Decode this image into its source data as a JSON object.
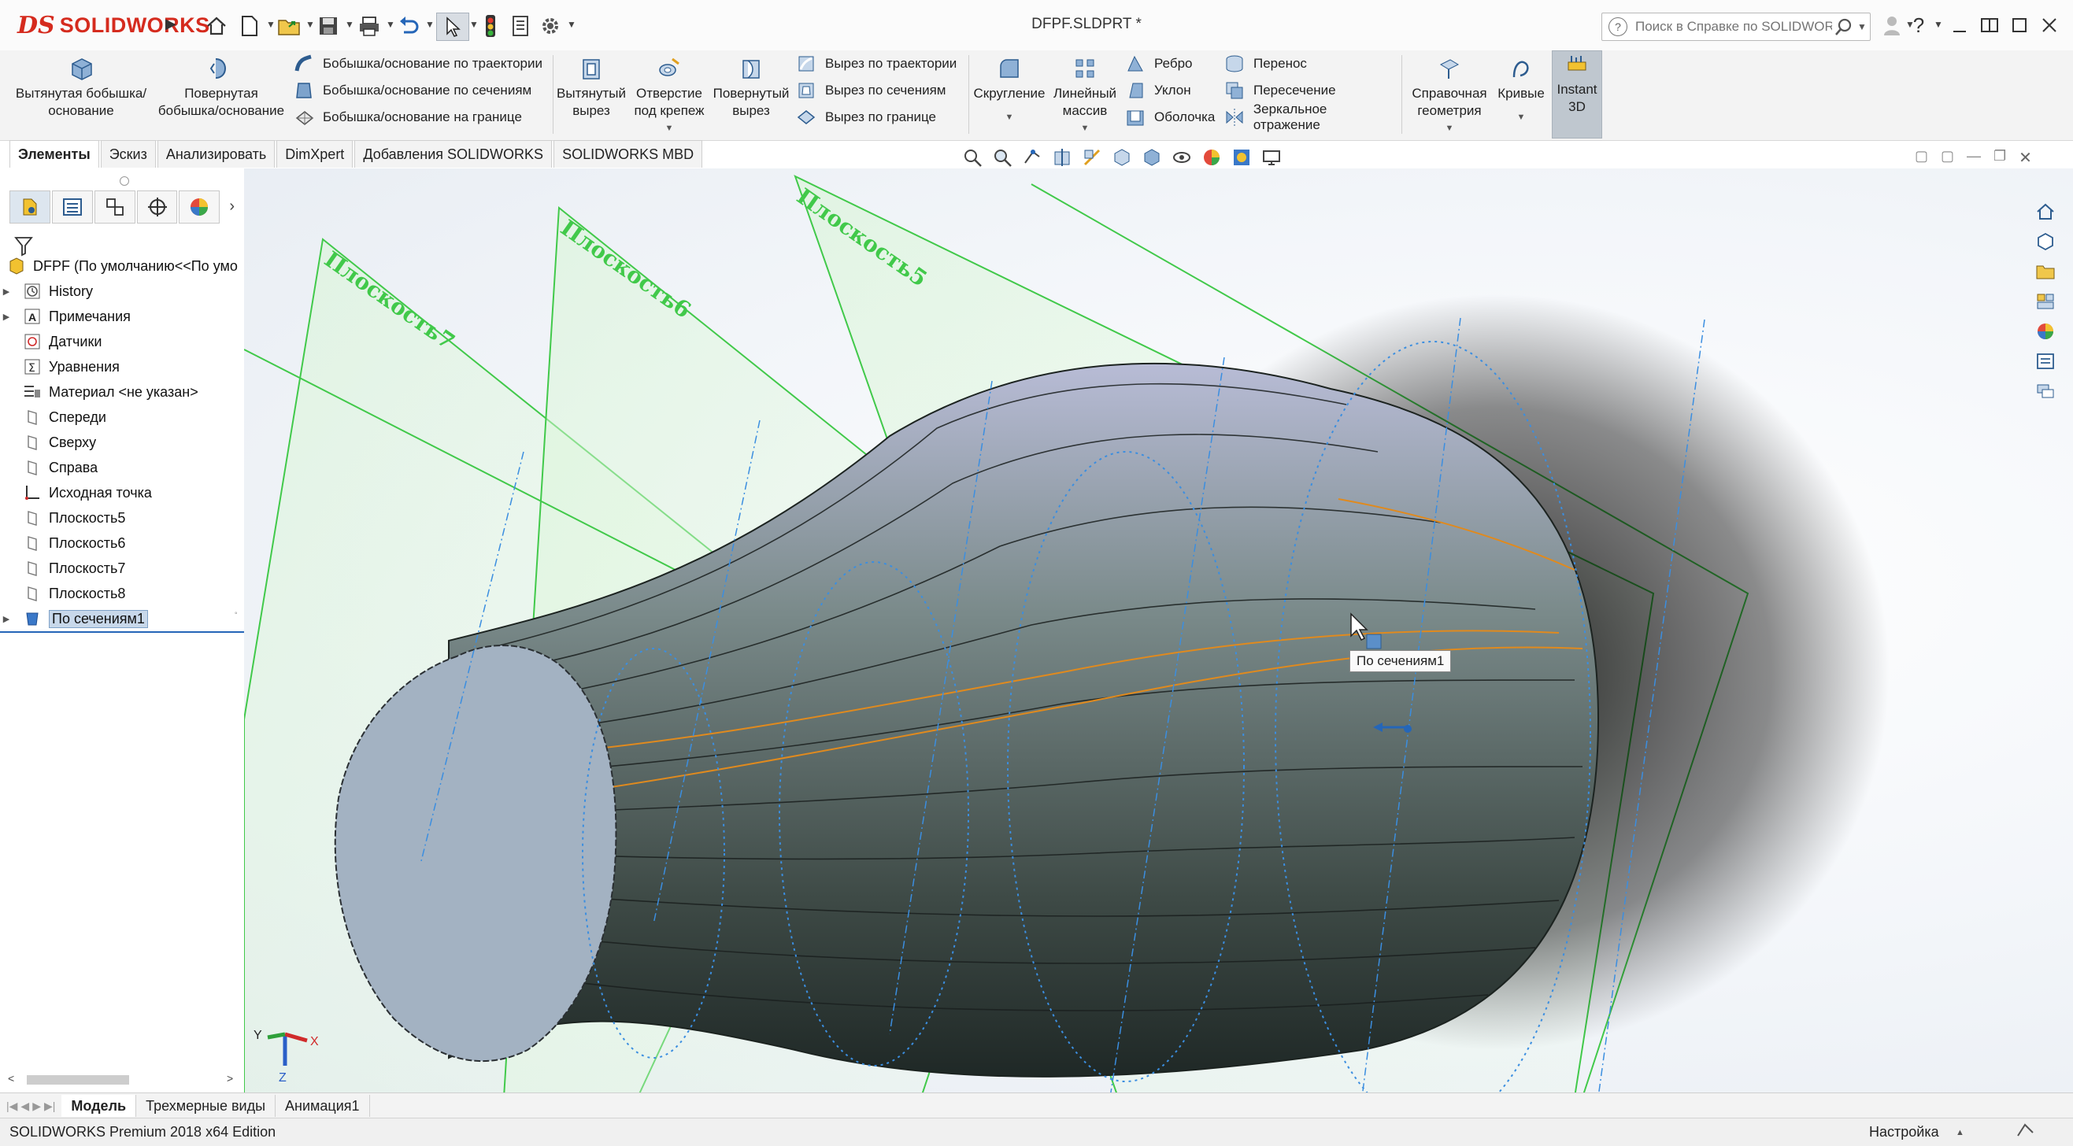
{
  "window": {
    "doc_title": "DFPF.SLDPRT *",
    "search_placeholder": "Поиск в Справке по SOLIDWORKS",
    "help_glyph": "?"
  },
  "ribbon": {
    "extruded_boss": "Вытянутая бобышка/основание",
    "revolved_boss": "Повернутая бобышка/основание",
    "swept_boss": "Бобышка/основание по траектории",
    "lofted_boss": "Бобышка/основание по сечениям",
    "boundary_boss": "Бобышка/основание на границе",
    "extruded_cut": "Вытянутый вырез",
    "hole_wizard": "Отверстие под крепеж",
    "revolved_cut": "Повернутый вырез",
    "swept_cut": "Вырез по траектории",
    "lofted_cut": "Вырез по сечениям",
    "boundary_cut": "Вырез по границе",
    "fillet": "Скругление",
    "linear_pattern": "Линейный массив",
    "rib": "Ребро",
    "draft": "Уклон",
    "shell": "Оболочка",
    "wrap": "Перенос",
    "intersect": "Пересечение",
    "mirror": "Зеркальное отражение",
    "reference_geometry": "Справочная геометрия",
    "curves": "Кривые",
    "instant3d": "Instant 3D"
  },
  "command_tabs": [
    "Элементы",
    "Эскиз",
    "Анализировать",
    "DimXpert",
    "Добавления SOLIDWORKS",
    "SOLIDWORKS MBD"
  ],
  "tree": {
    "root": "DFPF  (По умолчанию<<По умо",
    "items": [
      {
        "label": "History",
        "icon": "history-icon",
        "expandable": true
      },
      {
        "label": "Примечания",
        "icon": "annotations-icon",
        "expandable": true
      },
      {
        "label": "Датчики",
        "icon": "sensors-icon",
        "expandable": false
      },
      {
        "label": "Уравнения",
        "icon": "equations-icon",
        "expandable": false
      },
      {
        "label": "Материал <не указан>",
        "icon": "material-icon",
        "expandable": false
      },
      {
        "label": "Спереди",
        "icon": "plane-icon",
        "expandable": false
      },
      {
        "label": "Сверху",
        "icon": "plane-icon",
        "expandable": false
      },
      {
        "label": "Справа",
        "icon": "plane-icon",
        "expandable": false
      },
      {
        "label": "Исходная точка",
        "icon": "origin-icon",
        "expandable": false
      },
      {
        "label": "Плоскость5",
        "icon": "plane-icon",
        "expandable": false
      },
      {
        "label": "Плоскость6",
        "icon": "plane-icon",
        "expandable": false
      },
      {
        "label": "Плоскость7",
        "icon": "plane-icon",
        "expandable": false
      },
      {
        "label": "Плоскость8",
        "icon": "plane-icon",
        "expandable": false
      },
      {
        "label": "По сечениям1",
        "icon": "loft-icon",
        "expandable": true,
        "selected": true
      }
    ]
  },
  "viewport": {
    "plane_labels": [
      "Плоскость7",
      "Плоскость6",
      "Плоскость5"
    ],
    "tooltip": "По сечениям1",
    "triad": {
      "x": "X",
      "y": "Y",
      "z": "Z"
    }
  },
  "bottom_tabs": [
    "Модель",
    "Трехмерные виды",
    "Анимация1"
  ],
  "status": {
    "edition": "SOLIDWORKS Premium 2018 x64 Edition",
    "customize": "Настройка"
  },
  "colors": {
    "brand": "#d52b1e",
    "plane_green": "#41c94a",
    "sketch_blue": "#3b8ee0",
    "edge_orange": "#e08a1e",
    "selection": "#c8d8ea"
  }
}
